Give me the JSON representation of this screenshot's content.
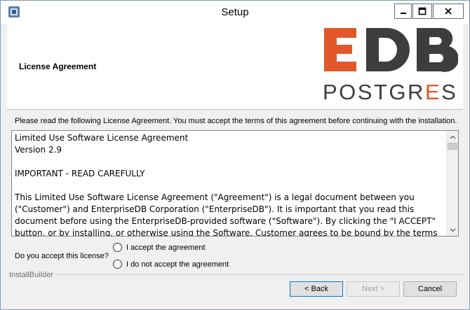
{
  "window": {
    "title": "Setup",
    "icon": "installer-app-icon",
    "controls": {
      "minimize": "minimize-icon",
      "maximize": "maximize-icon",
      "close": "close-icon"
    }
  },
  "header": {
    "title": "License Agreement",
    "logo": {
      "top_text": "EDB",
      "bottom_text_part1": "POSTGR",
      "bottom_text_accent": "E",
      "bottom_text_part2": "S",
      "accent_color": "#e2582b",
      "dark_color": "#3d3d3d"
    }
  },
  "content": {
    "instruction": "Please read the following License Agreement. You must accept the terms of this agreement before continuing with the installation.",
    "license_text": "Limited Use Software License Agreement\nVersion 2.9\n\nIMPORTANT - READ CAREFULLY\n\nThis Limited Use Software License Agreement (\"Agreement\") is a legal document between you (\"Customer\") and EnterpriseDB Corporation (\"EnterpriseDB\"). It is important that you read this document before using the EnterpriseDB-provided software (\"Software\"). By clicking the \"I ACCEPT\" button, or by installing, or otherwise using the Software, Customer agrees to be bound by the terms of this Agreement.",
    "question": "Do you accept this license?",
    "options": [
      {
        "label": "I accept the agreement",
        "selected": false
      },
      {
        "label": "I do not accept the agreement",
        "selected": false
      }
    ]
  },
  "footer": {
    "brand": "InstallBuilder",
    "back_label": "< Back",
    "next_label": "Next >",
    "next_enabled": false,
    "cancel_label": "Cancel"
  }
}
